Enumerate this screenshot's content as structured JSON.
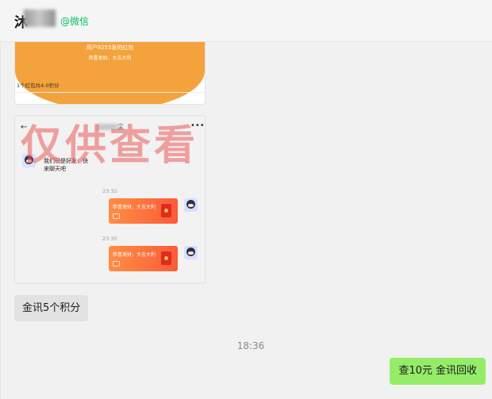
{
  "header": {
    "contact_name": "沐",
    "channel_tag": "@微信"
  },
  "redpacket_card": {
    "sender_line": "用户9255发的红包",
    "greeting": "恭喜发财，大吉大利",
    "summary": "1个红包共4.0积分"
  },
  "chat_screenshot": {
    "title_suffix": "尘",
    "menu_glyph": "•••",
    "back_glyph": "←",
    "incoming_message": "我们已是好友，快来聊天吧",
    "time1": "23:32",
    "time2": "23:35",
    "redpacket_text": "恭喜发财，大吉大利"
  },
  "watermark": "仅供查看",
  "messages": {
    "left_bubble": "金讯5个积分",
    "timestamp": "18:36",
    "right_bubble": "查10元  金讯回收"
  },
  "colors": {
    "wechat_green": "#07c160",
    "own_bubble": "#95ec69",
    "redpacket_orange": "#f4a23b",
    "watermark_red": "#ec5a5a"
  }
}
